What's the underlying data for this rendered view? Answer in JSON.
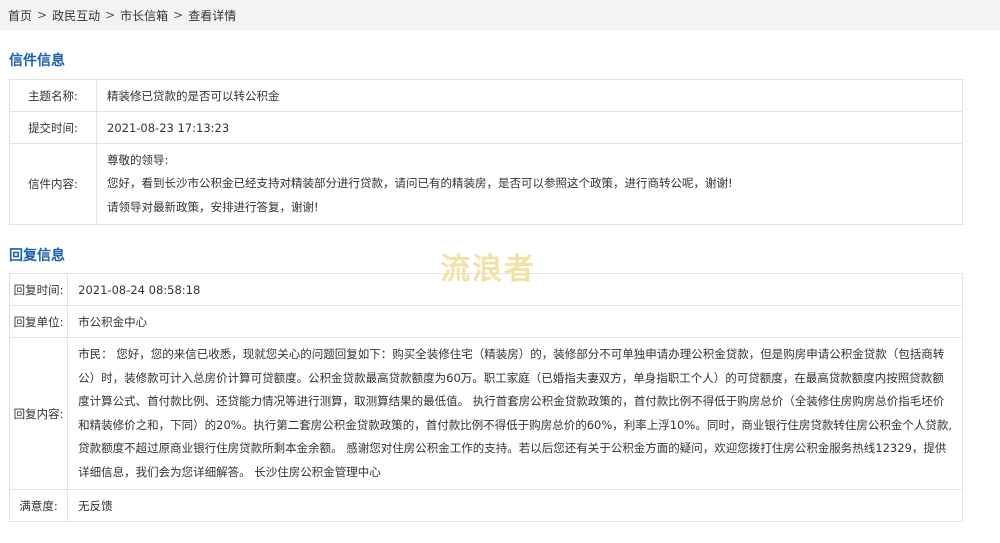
{
  "breadcrumb": {
    "items": [
      "首页",
      "政民互动",
      "市长信箱",
      "查看详情"
    ],
    "separator": ">"
  },
  "letter_section": {
    "title": "信件信息",
    "subject_label": "主题名称:",
    "subject_value": "精装修已贷款的是否可以转公积金",
    "time_label": "提交时间:",
    "time_value": "2021-08-23 17:13:23",
    "content_label": "信件内容:",
    "content_lines": [
      "尊敬的领导:",
      "您好，看到长沙市公积金已经支持对精装部分进行贷款，请问已有的精装房，是否可以参照这个政策，进行商转公呢，谢谢!",
      "请领导对最新政策，安排进行答复，谢谢!"
    ]
  },
  "reply_section": {
    "title": "回复信息",
    "time_label": "回复时间:",
    "time_value": "2021-08-24 08:58:18",
    "unit_label": "回复单位:",
    "unit_value": "市公积金中心",
    "content_label": "回复内容:",
    "content_lines": [
      "市民： 您好，您的来信已收悉，现就您关心的问题回复如下：购买全装修住宅（精装房）的，装修部分不可单独申请办理公积金贷款，但是购房申请公积金贷款（包括商转",
      "公）时，装修款可计入总房价计算可贷额度。公积金贷款最高贷款额度为60万。职工家庭（已婚指夫妻双方，单身指职工个人）的可贷额度，在最高贷款额度内按照贷款额",
      "度计算公式、首付款比例、还贷能力情况等进行测算，取测算结果的最低值。 执行首套房公积金贷款政策的，首付款比例不得低于购房总价（全装修住房购房总价指毛坯价",
      "和精装修价之和，下同）的20%。执行第二套房公积金贷款政策的，首付款比例不得低于购房总价的60%，利率上浮10%。同时，商业银行住房贷款转住房公积金个人贷款,",
      "贷款额度不超过原商业银行住房贷款所剩本金余额。 感谢您对住房公积金工作的支持。若以后您还有关于公积金方面的疑问，欢迎您拨打住房公积金服务热线12329，提供",
      "详细信息，我们会为您详细解答。 长沙住房公积金管理中心"
    ],
    "satisfaction_label": "满意度:",
    "satisfaction_value": "无反馈"
  },
  "watermark": "流浪者",
  "colors": {
    "section_title": "#1a61b0",
    "breadcrumb_bg": "#f3f3f3",
    "border": "#e3e3e3",
    "watermark": "#f1e3a6"
  }
}
